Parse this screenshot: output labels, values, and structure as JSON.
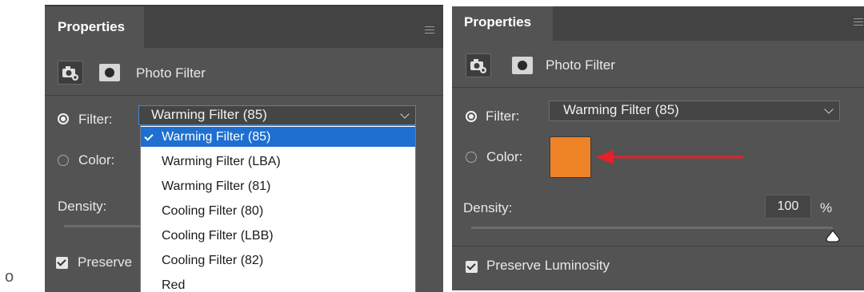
{
  "stray_char": "o",
  "left_panel": {
    "tab_title": "Properties",
    "adjustment_name": "Photo Filter",
    "filter_label": "Filter:",
    "filter_value": "Warming Filter (85)",
    "color_label": "Color:",
    "density_label": "Density:",
    "preserve_label": "Preserve",
    "dropdown_items": [
      "Warming Filter (85)",
      "Warming Filter (LBA)",
      "Warming Filter (81)",
      "Cooling Filter (80)",
      "Cooling Filter (LBB)",
      "Cooling Filter (82)",
      "Red"
    ],
    "selected_index": 0
  },
  "right_panel": {
    "tab_title": "Properties",
    "adjustment_name": "Photo Filter",
    "filter_label": "Filter:",
    "filter_value": "Warming Filter (85)",
    "color_label": "Color:",
    "color_swatch": "#ee8427",
    "density_label": "Density:",
    "density_value": "100",
    "density_unit": "%",
    "preserve_label": "Preserve Luminosity"
  },
  "colors": {
    "panel_bg": "#535353",
    "accent_blue": "#1e6fd0",
    "arrow_red": "#e4202a"
  },
  "icons": [
    "camera-adjustment-icon",
    "layer-mask-icon",
    "panel-menu-icon",
    "chevron-down-icon",
    "checkmark-icon",
    "red-arrow-annotation"
  ]
}
